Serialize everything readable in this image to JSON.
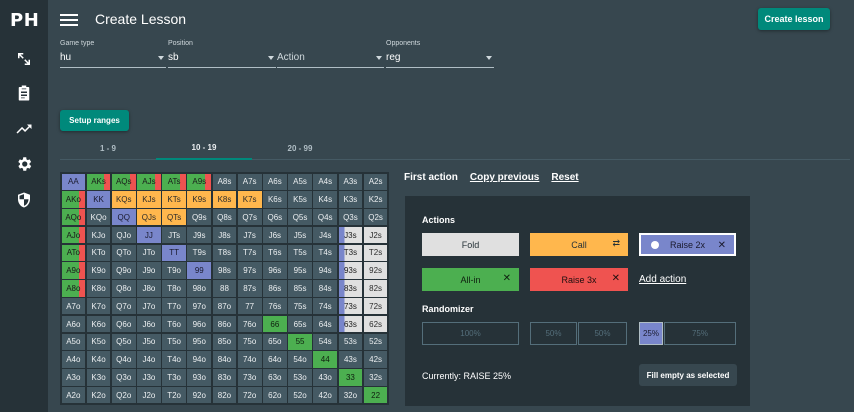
{
  "app": {
    "logo": "PH",
    "title": "Create Lesson",
    "create_button": "Create lesson"
  },
  "nav": {
    "icons": [
      "expand-icon",
      "clipboard-icon",
      "trending-up-icon",
      "gear-icon",
      "shield-icon"
    ]
  },
  "filters": {
    "game_type": {
      "label": "Game type",
      "value": "hu"
    },
    "position": {
      "label": "Position",
      "value": "sb"
    },
    "action": {
      "label": "",
      "value": "Action"
    },
    "opponents": {
      "label": "Opponents",
      "value": "reg"
    }
  },
  "setup_button": "Setup ranges",
  "tabs": [
    {
      "label": "1 - 9",
      "active": false
    },
    {
      "label": "10 - 19",
      "active": true
    },
    {
      "label": "20 - 99",
      "active": false
    }
  ],
  "colors": {
    "raise": "#7986cb",
    "call": "#ffb74d",
    "allin": "#4caf50",
    "fold": "#e0e0e0",
    "raise3x": "#ef5350",
    "accent": "#00897b"
  },
  "grid": {
    "hands": [
      [
        "AA",
        "AKs",
        "AQs",
        "AJs",
        "ATs",
        "A9s",
        "A8s",
        "A7s",
        "A6s",
        "A5s",
        "A4s",
        "A3s",
        "A2s"
      ],
      [
        "AKo",
        "KK",
        "KQs",
        "KJs",
        "KTs",
        "K9s",
        "K8s",
        "K7s",
        "K6s",
        "K5s",
        "K4s",
        "K3s",
        "K2s"
      ],
      [
        "AQo",
        "KQo",
        "QQ",
        "QJs",
        "QTs",
        "Q9s",
        "Q8s",
        "Q7s",
        "Q6s",
        "Q5s",
        "Q4s",
        "Q3s",
        "Q2s"
      ],
      [
        "AJo",
        "KJo",
        "QJo",
        "JJ",
        "JTs",
        "J9s",
        "J8s",
        "J7s",
        "J6s",
        "J5s",
        "J4s",
        "J3s",
        "J2s"
      ],
      [
        "ATo",
        "KTo",
        "QTo",
        "JTo",
        "TT",
        "T9s",
        "T8s",
        "T7s",
        "T6s",
        "T5s",
        "T4s",
        "T3s",
        "T2s"
      ],
      [
        "A9o",
        "K9o",
        "Q9o",
        "J9o",
        "T9o",
        "99",
        "98s",
        "97s",
        "96s",
        "95s",
        "94s",
        "93s",
        "92s"
      ],
      [
        "A8o",
        "K8o",
        "Q8o",
        "J8o",
        "T8o",
        "98o",
        "88",
        "87s",
        "86s",
        "85s",
        "84s",
        "83s",
        "82s"
      ],
      [
        "A7o",
        "K7o",
        "Q7o",
        "J7o",
        "T7o",
        "97o",
        "87o",
        "77",
        "76s",
        "75s",
        "74s",
        "73s",
        "72s"
      ],
      [
        "A6o",
        "K6o",
        "Q6o",
        "J6o",
        "T6o",
        "96o",
        "86o",
        "76o",
        "66",
        "65s",
        "64s",
        "63s",
        "62s"
      ],
      [
        "A5o",
        "K5o",
        "Q5o",
        "J5o",
        "T5o",
        "95o",
        "85o",
        "75o",
        "65o",
        "55",
        "54s",
        "53s",
        "52s"
      ],
      [
        "A4o",
        "K4o",
        "Q4o",
        "J4o",
        "T4o",
        "94o",
        "84o",
        "74o",
        "64o",
        "54o",
        "44",
        "43s",
        "42s"
      ],
      [
        "A3o",
        "K3o",
        "Q3o",
        "J3o",
        "T3o",
        "93o",
        "83o",
        "73o",
        "63o",
        "53o",
        "43o",
        "33",
        "32s"
      ],
      [
        "A2o",
        "K2o",
        "Q2o",
        "J2o",
        "T2o",
        "92o",
        "82o",
        "72o",
        "62o",
        "52o",
        "42o",
        "32o",
        "22"
      ]
    ],
    "actions": {
      "AA": "raise",
      "AKs": "allin|raise3x",
      "AQs": "allin|raise3x",
      "AJs": "allin|raise3x",
      "ATs": "allin|raise3x",
      "A9s": "allin|raise3x",
      "AKo": "allin|raise3x",
      "AQo": "allin|raise3x",
      "AJo": "allin|raise3x",
      "ATo": "allin|raise3x",
      "A9o": "allin|raise3x",
      "A8o": "allin|raise3x",
      "KK": "raise",
      "QQ": "raise",
      "JJ": "raise",
      "TT": "raise",
      "99": "raise",
      "KQs": "call",
      "KJs": "call",
      "KTs": "call",
      "K9s": "call",
      "K8s": "call",
      "K7s": "call",
      "QJs": "call",
      "QTs": "call",
      "66": "allin",
      "55": "allin",
      "44": "allin",
      "33": "allin",
      "22": "allin",
      "J3s": "partial",
      "T3s": "partial",
      "93s": "partial",
      "83s": "partial",
      "73s": "partial",
      "63s": "partial",
      "J2s": "fold",
      "T2s": "fold",
      "92s": "fold",
      "82s": "fold",
      "72s": "fold",
      "62s": "fold"
    }
  },
  "panel": {
    "links": [
      "First action",
      "Copy previous",
      "Reset"
    ],
    "actions_title": "Actions",
    "fold": "Fold",
    "call": "Call",
    "call_icon": "swap-icon",
    "raise": "Raise  2x",
    "allin": "All-in",
    "raise3x": "Raise  3x",
    "add_action": "Add action",
    "randomizer_title": "Randomizer",
    "randomizer": [
      "100%",
      "50%",
      "50%",
      "25%",
      "75%"
    ],
    "randomizer_selected": 3,
    "currently": "Currently: RAISE 25%",
    "fill_button": "Fill empty as selected"
  }
}
